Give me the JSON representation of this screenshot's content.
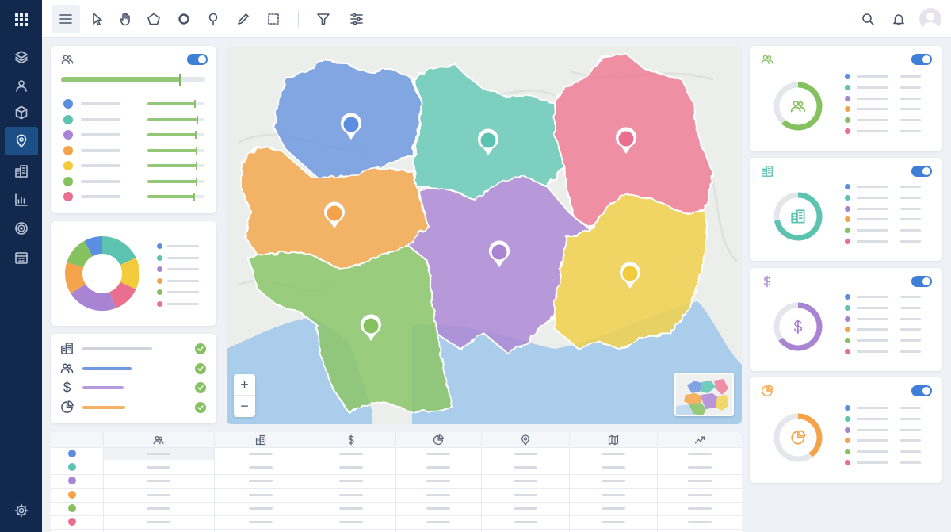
{
  "sidebar": {
    "icons": [
      "grid-apps-icon",
      "layers-icon",
      "users-icon",
      "polygon-box-icon",
      "location-pin-icon",
      "buildings-icon",
      "bar-chart-icon",
      "target-icon",
      "calendar-table-icon",
      "settings-icon"
    ],
    "active": "location-pin-icon"
  },
  "toolbar": {
    "tools": [
      "menu-icon",
      "pointer-icon",
      "hand-pan-icon",
      "polygon-draw-icon",
      "circle-draw-icon",
      "pin-draw-icon",
      "pencil-draw-icon",
      "rect-select-icon",
      "filter-icon",
      "sliders-icon"
    ],
    "right": [
      "search-icon",
      "bell-icon",
      "user-avatar"
    ]
  },
  "zoom": {
    "plus": "+",
    "minus": "−"
  },
  "colors": {
    "blue": "#5b8ede",
    "teal": "#5cc3b1",
    "purple": "#a884d3",
    "orange": "#f4a34a",
    "yellow": "#f2cc3c",
    "green": "#86c160",
    "pink": "#ea6f8e",
    "accent": "#3f7fd8",
    "sidebar": "#13284d"
  },
  "population_card": {
    "slider_level": 0.93,
    "progress": [
      0.83,
      0.88,
      0.85,
      0.86,
      0.86,
      0.86,
      0.82
    ]
  },
  "overview_donut": {
    "slices": [
      {
        "color": "teal",
        "value": 18
      },
      {
        "color": "yellow",
        "value": 14
      },
      {
        "color": "pink",
        "value": 12
      },
      {
        "color": "purple",
        "value": 22
      },
      {
        "color": "orange",
        "value": 14
      },
      {
        "color": "green",
        "value": 12
      },
      {
        "color": "blue",
        "value": 8
      }
    ]
  },
  "layers_card": {
    "items": [
      "buildings-icon",
      "users-icon",
      "dollar-icon",
      "pie-chart-icon"
    ],
    "checked": [
      true,
      true,
      true,
      true
    ]
  },
  "right_cards": [
    {
      "icon": "users-icon",
      "center_icon": "users-icon",
      "color": "#86c160",
      "fill": 0.62
    },
    {
      "icon": "buildings-icon",
      "center_icon": "buildings-icon",
      "color": "#5cc3b1",
      "fill": 0.72
    },
    {
      "icon": "dollar-icon",
      "center_icon": "dollar-icon",
      "color": "#a884d3",
      "fill": 0.65
    },
    {
      "icon": "pie-chart-icon",
      "center_icon": "pie-chart-icon",
      "color": "#f4a34a",
      "fill": 0.4
    }
  ],
  "table": {
    "headers": [
      "users-icon",
      "buildings-icon",
      "dollar-icon",
      "pie-chart-icon",
      "location-pin-icon",
      "map-icon",
      "trend-icon"
    ],
    "rows": [
      "blue",
      "teal",
      "purple",
      "orange",
      "green",
      "pink"
    ]
  }
}
